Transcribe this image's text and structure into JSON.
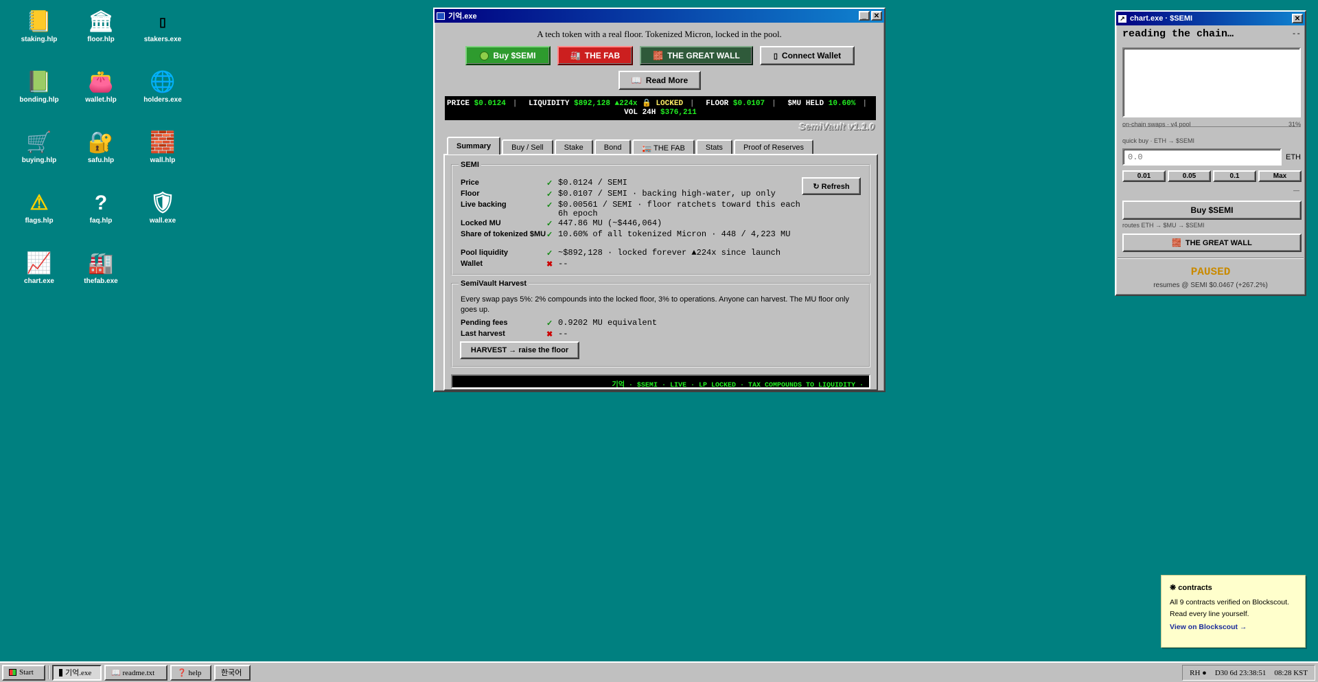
{
  "desktop_icons": [
    {
      "label": "staking.hlp",
      "icon": "notebook-icon",
      "glyph": "📒"
    },
    {
      "label": "floor.hlp",
      "icon": "bank-icon",
      "glyph": "🏛"
    },
    {
      "label": "stakers.exe",
      "icon": "blank-icon",
      "glyph": "▯"
    },
    {
      "label": "bonding.hlp",
      "icon": "green-book-icon",
      "glyph": "📗"
    },
    {
      "label": "wallet.hlp",
      "icon": "purse-icon",
      "glyph": "👛"
    },
    {
      "label": "holders.exe",
      "icon": "globe-icon",
      "glyph": "🌐"
    },
    {
      "label": "buying.hlp",
      "icon": "cart-icon",
      "glyph": "🛒"
    },
    {
      "label": "safu.hlp",
      "icon": "lock-icon",
      "glyph": "🔐"
    },
    {
      "label": "wall.hlp",
      "icon": "brick-icon",
      "glyph": "🧱"
    },
    {
      "label": "flags.hlp",
      "icon": "warning-icon",
      "glyph": "⚠"
    },
    {
      "label": "faq.hlp",
      "icon": "question-icon",
      "glyph": "?"
    },
    {
      "label": "wall.exe",
      "icon": "shield-icon",
      "glyph": "🛡"
    },
    {
      "label": "chart.exe",
      "icon": "chart-icon",
      "glyph": "📈"
    },
    {
      "label": "thefab.exe",
      "icon": "factory-icon",
      "glyph": "🏭"
    }
  ],
  "main": {
    "title": "기억.exe",
    "tagline": "A tech token with a real floor. Tokenized Micron, locked in the pool.",
    "buttons": {
      "buy": "Buy $SEMI",
      "fab": "THE FAB",
      "wall": "THE GREAT WALL",
      "connect": "Connect Wallet",
      "read_more": "Read More"
    },
    "ticker": {
      "price_label": "PRICE",
      "price_value": "$0.0124",
      "liquidity_label": "LIQUIDITY",
      "liquidity_value": "$892,128 ▲224x",
      "locked_label": "🔒 LOCKED",
      "floor_label": "FLOOR",
      "floor_value": "$0.0107",
      "held_label": "$MU HELD",
      "held_value": "10.60%",
      "vol_label": "VOL 24H",
      "vol_value": "$376,211"
    },
    "version": "SemiVault v1.1.0",
    "tabs": [
      "Summary",
      "Buy / Sell",
      "Stake",
      "Bond",
      "🏣 THE FAB",
      "Stats",
      "Proof of Reserves"
    ],
    "semi_group": {
      "legend": "SEMI",
      "refresh": "↻ Refresh",
      "rows": [
        {
          "k": "Price",
          "status": "✓",
          "v": "$0.0124 / SEMI"
        },
        {
          "k": "Floor",
          "status": "✓",
          "v": "$0.0107 / SEMI · backing high-water, up only"
        },
        {
          "k": "Live backing",
          "status": "✓",
          "v": "$0.00561 / SEMI · floor ratchets toward this each 6h epoch"
        },
        {
          "k": "Locked MU",
          "status": "✓",
          "v": "447.86 MU (~$446,064)"
        },
        {
          "k": "Share of tokenized $MU",
          "status": "✓",
          "v": "10.60% of all tokenized Micron · 448 / 4,223 MU"
        },
        {
          "k": "Pool liquidity",
          "status": "✓",
          "v": "~$892,128 · locked forever ▲224x since launch"
        },
        {
          "k": "Wallet",
          "status": "✖",
          "v": "--"
        }
      ]
    },
    "harvest_group": {
      "legend": "SemiVault Harvest",
      "desc": "Every swap pays 5%: 2% compounds into the locked floor, 3% to operations. Anyone can harvest. The MU floor only goes up.",
      "rows": [
        {
          "k": "Pending fees",
          "status": "✓",
          "v": "0.9202 MU equivalent"
        },
        {
          "k": "Last harvest",
          "status": "✖",
          "v": "--"
        }
      ],
      "button": "HARVEST → raise the floor"
    },
    "marquee": "기억 · $SEMI · LIVE · LP LOCKED · TAX COMPOUNDS TO LIQUIDITY ·"
  },
  "chart": {
    "title": "chart.exe · $SEMI",
    "status": "reading the chain…",
    "status_right": "--",
    "source": "on-chain swaps · v4 pool",
    "pct": "31%",
    "quick_label": "quick buy · ETH → $SEMI",
    "eth_placeholder": "0.0",
    "eth_unit": "ETH",
    "amounts": [
      "0.01",
      "0.05",
      "0.1",
      "Max"
    ],
    "dash": "—",
    "buy": "Buy $SEMI",
    "route": "routes ETH → $MU → $SEMI",
    "wall": "THE GREAT WALL",
    "paused": "PAUSED",
    "resumes": "resumes @ SEMI $0.0467 (+267.2%)"
  },
  "note": {
    "title": "❋ contracts",
    "body": "All 9 contracts verified on Blockscout. Read every line yourself.",
    "link": "View on Blockscout →"
  },
  "taskbar": {
    "start": "Start",
    "items": [
      "기억.exe",
      "📖 readme.txt",
      "❓ help",
      "한국어"
    ],
    "tray_rh": "RH ●",
    "tray_date": "D30 6d 23:38:51",
    "tray_time": "08:28 KST"
  },
  "colors": {
    "desktop": "#008080",
    "title_gradient_start": "#000080",
    "buy_green": "#2e9b2e",
    "fab_red": "#cc1f1f",
    "wall_green": "#2f5a3a"
  }
}
